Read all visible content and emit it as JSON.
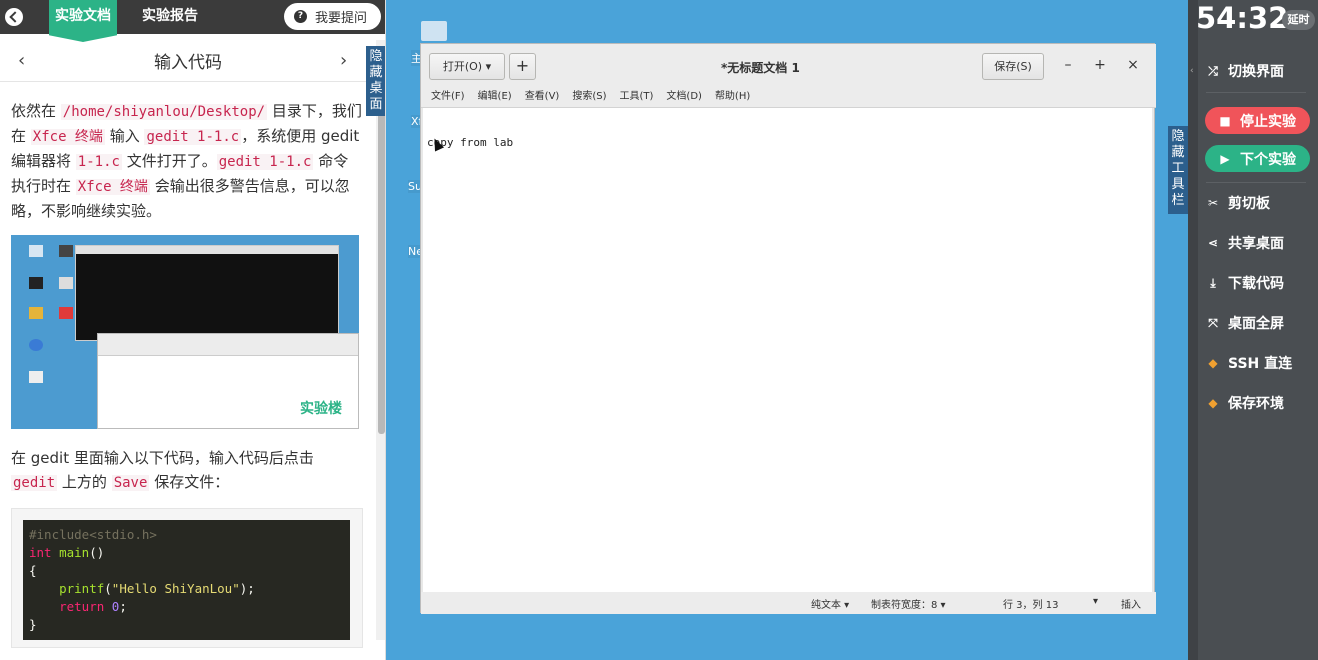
{
  "left_panel": {
    "tabs": {
      "doc": "实验文档",
      "report": "实验报告"
    },
    "ask_button": "我要提问",
    "nav_title": "输入代码",
    "nav_prev": "‹",
    "nav_next": "›",
    "hide_desktop": "隐藏桌面",
    "para1": {
      "t1": "依然在 ",
      "c1": "/home/shiyanlou/Desktop/",
      "t2": " 目录下，我们在 ",
      "c2": "Xfce 终端",
      "t3": " 输入 ",
      "c3": "gedit 1-1.c",
      "t4": "，系统便用 gedit 编辑器将 ",
      "c4": "1-1.c",
      "t5": " 文件打开了。",
      "c5": "gedit 1-1.c",
      "t6": " 命令执行时在 ",
      "c6": "Xfce 终端",
      "t7": " 会输出很多警告信息，可以忽略，不影响继续实验。"
    },
    "screenshot_logo": "实验楼",
    "para2": {
      "t1": "在 gedit 里面输入以下代码，输入代码后点击 ",
      "c1": "gedit",
      "t2": " 上方的 ",
      "c2": "Save",
      "t3": " 保存文件："
    },
    "code": {
      "line1": "#include<stdio.h>",
      "line2_kw": "int",
      "line2_fn": "main",
      "line2_rest": "()",
      "line3": "{",
      "line4_fn": "printf",
      "line4_open": "(",
      "line4_str": "\"Hello ShiYanLou\"",
      "line4_close": ");",
      "line5_kw": "return",
      "line5_num": "0",
      "line5_end": ";",
      "line6": "}"
    }
  },
  "desktop": {
    "labels": [
      "主",
      "Xf",
      "Su",
      "Ne"
    ],
    "gedit": {
      "open_button": "打开(O)",
      "new_button": "+",
      "title": "*无标题文档 1",
      "save_button": "保存(S)",
      "minimize": "–",
      "maximize": "+",
      "close": "×",
      "menu": [
        "文件(F)",
        "编辑(E)",
        "查看(V)",
        "搜索(S)",
        "工具(T)",
        "文档(D)",
        "帮助(H)"
      ],
      "editor_text": "copy from lab",
      "status": {
        "syntax": "纯文本 ▾",
        "tab_width": "制表符宽度：8 ▾",
        "position": "行 3，列 13",
        "dropdown": "▾",
        "mode": "插入"
      }
    },
    "hide_toolbar": "隐藏工具栏"
  },
  "right_panel": {
    "timer": "54:32",
    "extend": "延时",
    "switch_ui": "切换界面",
    "stop": "停止实验",
    "next": "下个实验",
    "clipboard": "剪切板",
    "share": "共享桌面",
    "download": "下载代码",
    "fullscreen": "桌面全屏",
    "ssh": "SSH 直连",
    "save_env": "保存环境",
    "colors": {
      "stop": "#f0545a",
      "next": "#2cb387",
      "accent": "#2cb387"
    }
  }
}
